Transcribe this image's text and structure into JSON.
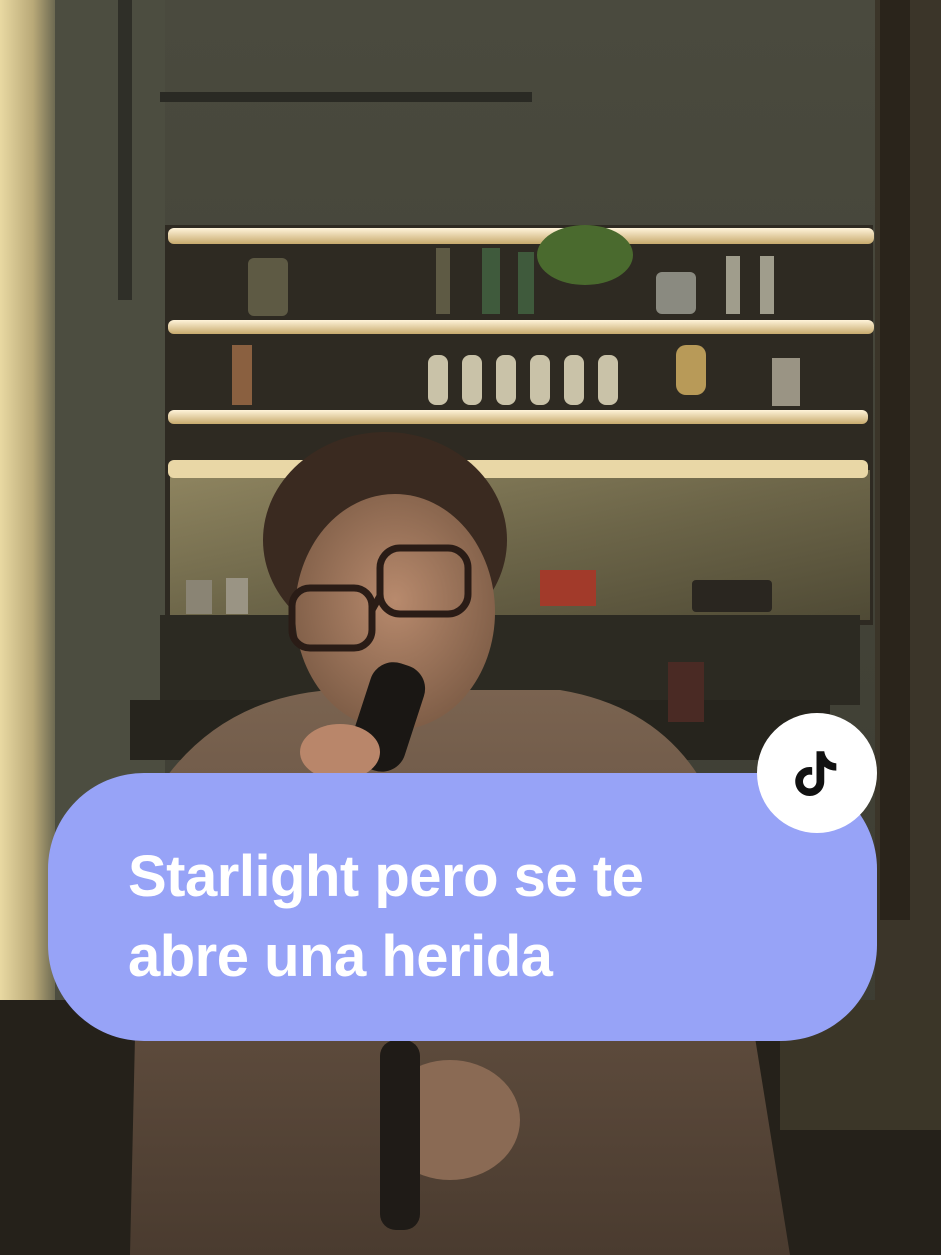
{
  "caption": {
    "line1": "Starlight pero se te",
    "line2": "abre una herida"
  },
  "badge": {
    "icon": "tiktok-note-icon",
    "color": "#ffffff"
  },
  "colors": {
    "caption_background": "#97a3f7",
    "caption_text": "#ffffff",
    "icon": "#111111"
  }
}
